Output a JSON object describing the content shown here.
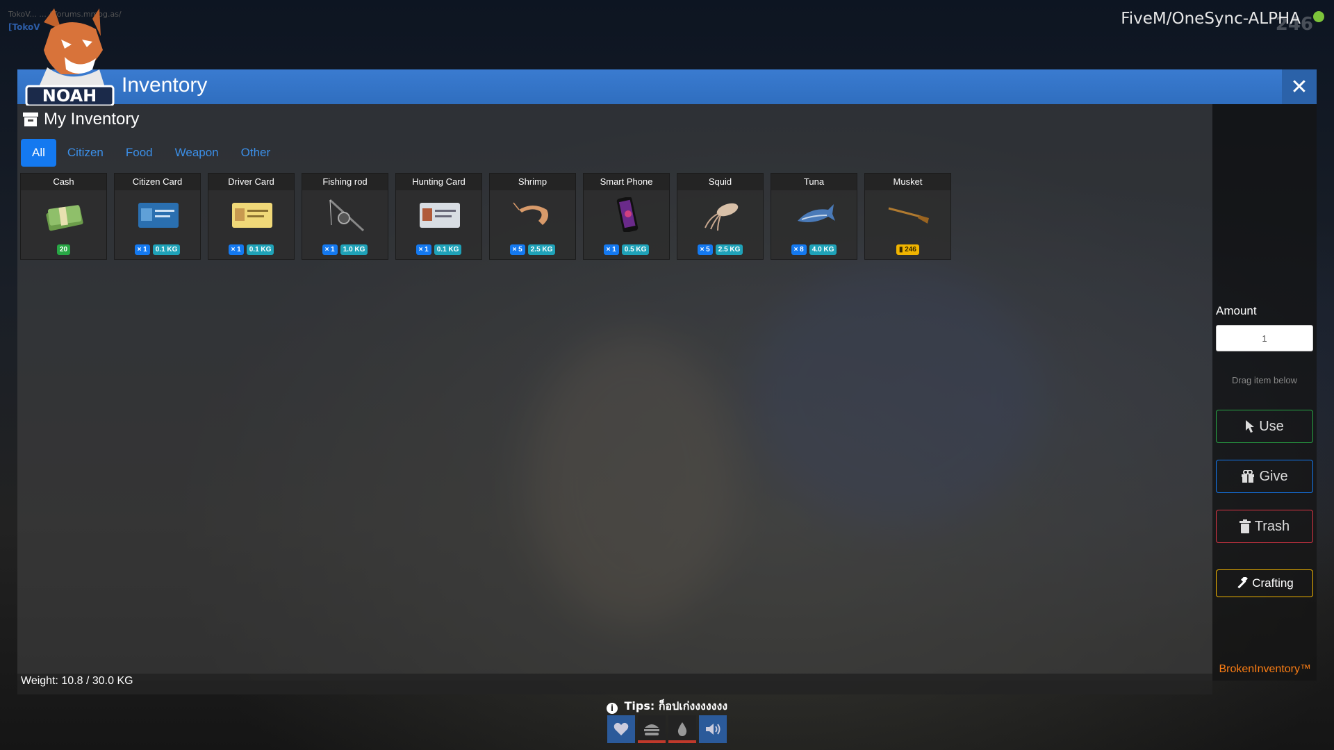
{
  "overlay": {
    "server_line": "TokoV... ... //forums.mmog.as/",
    "tag": "[TokoV"
  },
  "server": {
    "name": "FiveM/OneSync-ALPHA",
    "count": "246"
  },
  "window": {
    "title": "Inventory",
    "close_symbol": "✕",
    "logo_text": "NOAH"
  },
  "inventory": {
    "header": "My Inventory",
    "tabs": [
      {
        "label": "All",
        "active": true
      },
      {
        "label": "Citizen",
        "active": false
      },
      {
        "label": "Food",
        "active": false
      },
      {
        "label": "Weapon",
        "active": false
      },
      {
        "label": "Other",
        "active": false
      }
    ],
    "items": [
      {
        "name": "Cash",
        "icon": "cash-icon",
        "badges": [
          {
            "text": "20",
            "color": "green"
          }
        ]
      },
      {
        "name": "Citizen Card",
        "icon": "citizen-card-icon",
        "badges": [
          {
            "text": "× 1",
            "color": "blue"
          },
          {
            "text": "0.1 KG",
            "color": "teal"
          }
        ]
      },
      {
        "name": "Driver Card",
        "icon": "driver-card-icon",
        "badges": [
          {
            "text": "× 1",
            "color": "blue"
          },
          {
            "text": "0.1 KG",
            "color": "teal"
          }
        ]
      },
      {
        "name": "Fishing rod",
        "icon": "fishing-rod-icon",
        "badges": [
          {
            "text": "× 1",
            "color": "blue"
          },
          {
            "text": "1.0 KG",
            "color": "teal"
          }
        ]
      },
      {
        "name": "Hunting Card",
        "icon": "hunting-card-icon",
        "badges": [
          {
            "text": "× 1",
            "color": "blue"
          },
          {
            "text": "0.1 KG",
            "color": "teal"
          }
        ]
      },
      {
        "name": "Shrimp",
        "icon": "shrimp-icon",
        "badges": [
          {
            "text": "× 5",
            "color": "blue"
          },
          {
            "text": "2.5 KG",
            "color": "teal"
          }
        ]
      },
      {
        "name": "Smart Phone",
        "icon": "smartphone-icon",
        "badges": [
          {
            "text": "× 1",
            "color": "blue"
          },
          {
            "text": "0.5 KG",
            "color": "teal"
          }
        ]
      },
      {
        "name": "Squid",
        "icon": "squid-icon",
        "badges": [
          {
            "text": "× 5",
            "color": "blue"
          },
          {
            "text": "2.5 KG",
            "color": "teal"
          }
        ]
      },
      {
        "name": "Tuna",
        "icon": "tuna-icon",
        "badges": [
          {
            "text": "× 8",
            "color": "blue"
          },
          {
            "text": "4.0 KG",
            "color": "teal"
          }
        ]
      },
      {
        "name": "Musket",
        "icon": "musket-icon",
        "badges": [
          {
            "text": "▮ 246",
            "color": "yellow"
          }
        ]
      }
    ],
    "weight": "Weight: 10.8 / 30.0 KG"
  },
  "actions": {
    "amount_label": "Amount",
    "amount_value": "1",
    "drag_hint": "Drag item below",
    "use": "Use",
    "give": "Give",
    "trash": "Trash",
    "crafting": "Crafting",
    "brand": "BrokenInventory™"
  },
  "hud": {
    "tips": "Tips: ก็อปเก่งงงงงงง",
    "statuses": [
      {
        "icon": "heart-icon",
        "line_color": "#2b62a9"
      },
      {
        "icon": "burger-icon",
        "line_color": "#c0392b"
      },
      {
        "icon": "water-drop-icon",
        "line_color": "#c0392b"
      },
      {
        "icon": "speaker-icon",
        "line_color": "#2b62a9"
      }
    ]
  },
  "colors": {
    "titlebar": "#3a7bd0",
    "accent": "#1479f0",
    "brand": "#fd7e14"
  }
}
